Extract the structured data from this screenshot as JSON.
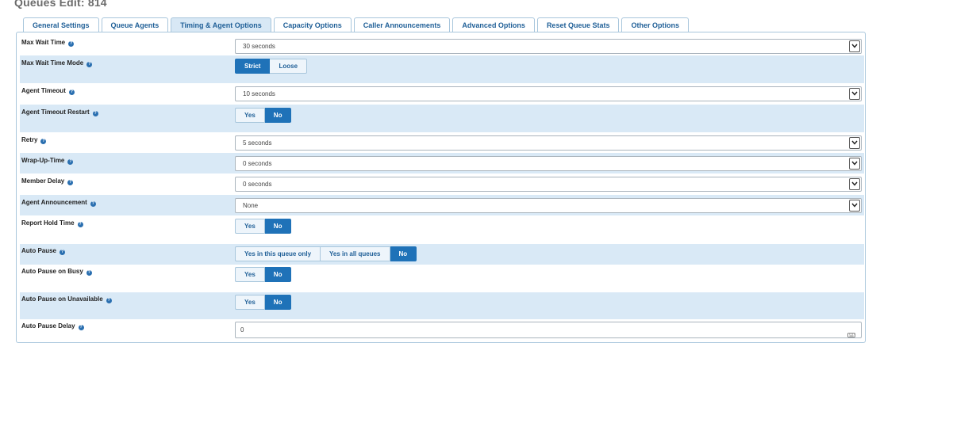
{
  "page": {
    "title": "Queues Edit: 814"
  },
  "tabs": [
    {
      "label": "General Settings",
      "active": false
    },
    {
      "label": "Queue Agents",
      "active": false
    },
    {
      "label": "Timing & Agent Options",
      "active": true
    },
    {
      "label": "Capacity Options",
      "active": false
    },
    {
      "label": "Caller Announcements",
      "active": false
    },
    {
      "label": "Advanced Options",
      "active": false
    },
    {
      "label": "Reset Queue Stats",
      "active": false
    },
    {
      "label": "Other Options",
      "active": false
    }
  ],
  "fields": {
    "max_wait_time": {
      "label": "Max Wait Time",
      "value": "30 seconds"
    },
    "max_wait_time_mode": {
      "label": "Max Wait Time Mode",
      "options": [
        "Strict",
        "Loose"
      ],
      "selected": "Strict"
    },
    "agent_timeout": {
      "label": "Agent Timeout",
      "value": "10 seconds"
    },
    "agent_timeout_restart": {
      "label": "Agent Timeout Restart",
      "options": [
        "Yes",
        "No"
      ],
      "selected": "No"
    },
    "retry": {
      "label": "Retry",
      "value": "5 seconds"
    },
    "wrap_up_time": {
      "label": "Wrap-Up-Time",
      "value": "0 seconds"
    },
    "member_delay": {
      "label": "Member Delay",
      "value": "0 seconds"
    },
    "agent_announcement": {
      "label": "Agent Announcement",
      "value": "None"
    },
    "report_hold_time": {
      "label": "Report Hold Time",
      "options": [
        "Yes",
        "No"
      ],
      "selected": "No"
    },
    "auto_pause": {
      "label": "Auto Pause",
      "options": [
        "Yes in this queue only",
        "Yes in all queues",
        "No"
      ],
      "selected": "No"
    },
    "auto_pause_busy": {
      "label": "Auto Pause on Busy",
      "options": [
        "Yes",
        "No"
      ],
      "selected": "No"
    },
    "auto_pause_unavailable": {
      "label": "Auto Pause on Unavailable",
      "options": [
        "Yes",
        "No"
      ],
      "selected": "No"
    },
    "auto_pause_delay": {
      "label": "Auto Pause Delay",
      "value": "0"
    }
  },
  "colors": {
    "accent": "#1f72b8",
    "row_shade": "#d9e9f6",
    "border": "#a8c6dc",
    "title": "#6b6b6b"
  },
  "icons": {
    "help": "help-question-icon",
    "select_caret": "chevron-down-icon",
    "keyboard": "keyboard-icon"
  }
}
